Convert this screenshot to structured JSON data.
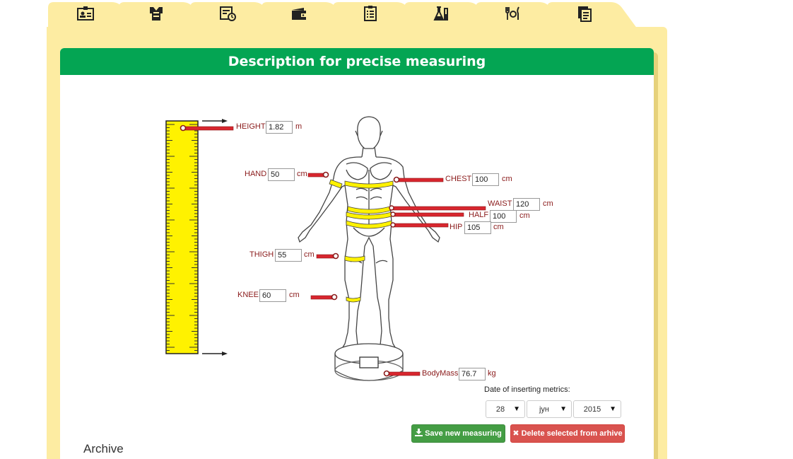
{
  "tabs": [
    {
      "icon": "id-card-icon"
    },
    {
      "icon": "body-shirt-icon",
      "active": true
    },
    {
      "icon": "calendar-clock-icon"
    },
    {
      "icon": "wallet-icon"
    },
    {
      "icon": "clipboard-list-icon"
    },
    {
      "icon": "lab-flask-icon"
    },
    {
      "icon": "food-cutlery-icon"
    },
    {
      "icon": "copy-documents-icon"
    }
  ],
  "card": {
    "title": "Description for precise measuring"
  },
  "measurements": {
    "height": {
      "label": "HEIGHT",
      "value": "1.82",
      "unit": "m"
    },
    "hand": {
      "label": "HAND",
      "value": "50",
      "unit": "cm"
    },
    "chest": {
      "label": "CHEST",
      "value": "100",
      "unit": "cm"
    },
    "waist": {
      "label": "WAIST",
      "value": "120",
      "unit": "cm"
    },
    "half": {
      "label": "HALF",
      "value": "100",
      "unit": "cm"
    },
    "hip": {
      "label": "HIP",
      "value": "105",
      "unit": "cm"
    },
    "thigh": {
      "label": "THIGH",
      "value": "55",
      "unit": "cm"
    },
    "knee": {
      "label": "KNEE",
      "value": "60",
      "unit": "cm"
    },
    "bodymass": {
      "label": "BodyMass",
      "value": "76.7",
      "unit": "kg"
    }
  },
  "date": {
    "label": "Date of inserting metrics:",
    "day": "28",
    "month": "јун",
    "year": "2015"
  },
  "buttons": {
    "save": "Save new measuring",
    "delete": "Delete selected from arhive"
  },
  "archive": {
    "title": "Archive"
  },
  "colors": {
    "header": "#04a553",
    "panel": "#fdeca2",
    "save": "#449d44",
    "delete": "#d9534f",
    "ruler": "#fff200",
    "marker": "#d8262e"
  }
}
